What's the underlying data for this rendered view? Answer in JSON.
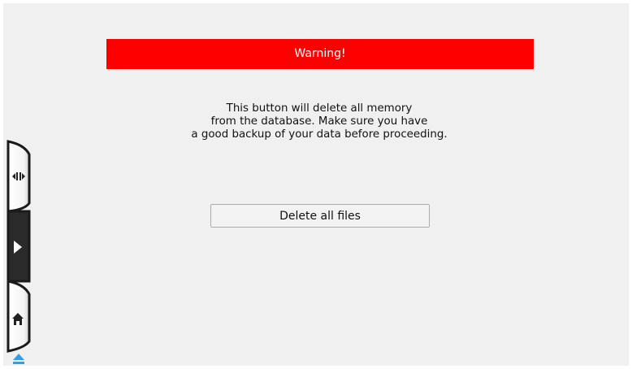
{
  "warning": {
    "title": "Warning!",
    "color": "#ff0000"
  },
  "message": {
    "lines": [
      "This button will delete all memory",
      "from the database.  Make sure you have",
      "a good backup of your data before proceeding."
    ]
  },
  "actions": {
    "delete_label": "Delete all files"
  },
  "side_nav": {
    "items": [
      {
        "icon": "shrink-arrows-icon"
      },
      {
        "icon": "play-triangle-icon",
        "active": true
      },
      {
        "icon": "home-icon"
      },
      {
        "icon": "eject-icon"
      }
    ],
    "accent": "#2ea0e8"
  }
}
